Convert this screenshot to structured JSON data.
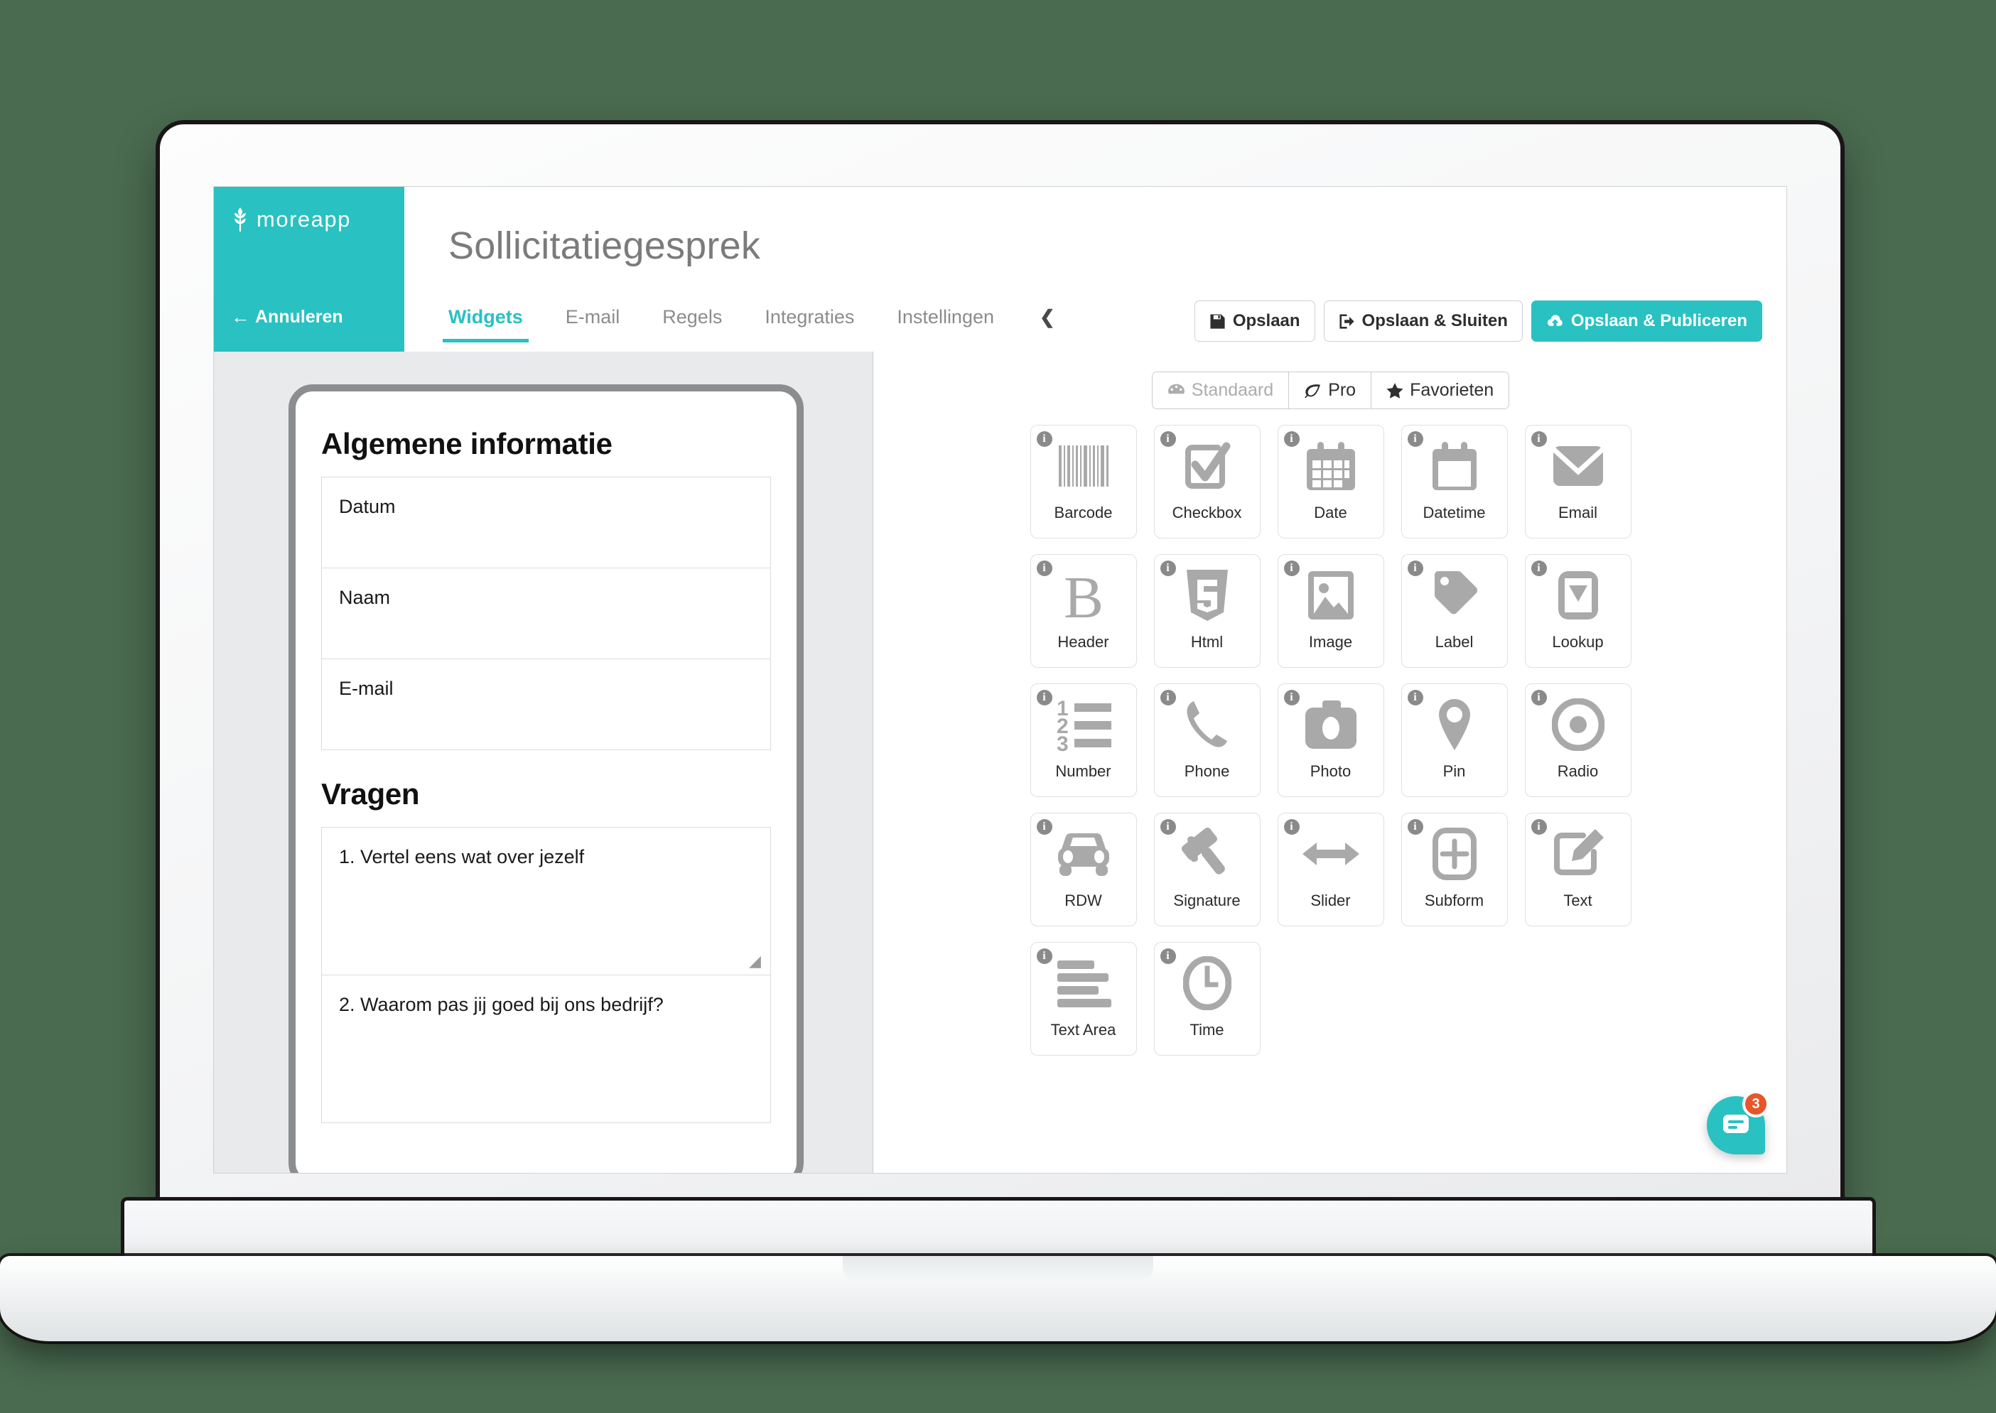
{
  "brand": {
    "logo_icon": "wheat-icon",
    "name": "moreapp",
    "cancel_label": "Annuleren",
    "cancel_icon": "arrow-left-icon",
    "color": "#29c1c1"
  },
  "header": {
    "form_title": "Sollicitatiegesprek"
  },
  "nav": {
    "tabs": [
      {
        "label": "Widgets",
        "active": true
      },
      {
        "label": "E-mail",
        "active": false
      },
      {
        "label": "Regels",
        "active": false
      },
      {
        "label": "Integraties",
        "active": false
      },
      {
        "label": "Instellingen",
        "active": false
      }
    ],
    "collapse_icon": "chevron-left-icon"
  },
  "actions": [
    {
      "label": "Opslaan",
      "icon": "floppy-disk-icon",
      "style": "default"
    },
    {
      "label": "Opslaan & Sluiten",
      "icon": "exit-icon",
      "style": "default"
    },
    {
      "label": "Opslaan & Publiceren",
      "icon": "cloud-upload-icon",
      "style": "primary"
    }
  ],
  "preview": {
    "sections": [
      {
        "title": "Algemene informatie",
        "fields": [
          {
            "label": "Datum",
            "tall": false
          },
          {
            "label": "Naam",
            "tall": false
          },
          {
            "label": "E-mail",
            "tall": false
          }
        ]
      },
      {
        "title": "Vragen",
        "fields": [
          {
            "label": "1. Vertel eens wat over jezelf",
            "tall": true,
            "resizable": true
          },
          {
            "label": "2. Waarom pas jij goed bij ons bedrijf?",
            "tall": true,
            "resizable": false
          }
        ]
      }
    ]
  },
  "widget_panel": {
    "categories": [
      {
        "label": "Standaard",
        "icon": "widgets-icon",
        "selected": true,
        "muted": true
      },
      {
        "label": "Pro",
        "icon": "leaf-icon",
        "selected": false,
        "muted": false
      },
      {
        "label": "Favorieten",
        "icon": "star-icon",
        "selected": false,
        "muted": false
      }
    ],
    "info_badge": "i",
    "widgets": [
      {
        "label": "Barcode",
        "icon": "barcode-icon"
      },
      {
        "label": "Checkbox",
        "icon": "checkbox-icon"
      },
      {
        "label": "Date",
        "icon": "calendar-icon"
      },
      {
        "label": "Datetime",
        "icon": "calendar-blank-icon"
      },
      {
        "label": "Email",
        "icon": "envelope-icon"
      },
      {
        "label": "Header",
        "icon": "bold-b-icon"
      },
      {
        "label": "Html",
        "icon": "html5-icon"
      },
      {
        "label": "Image",
        "icon": "picture-icon"
      },
      {
        "label": "Label",
        "icon": "tag-icon"
      },
      {
        "label": "Lookup",
        "icon": "dropdown-icon"
      },
      {
        "label": "Number",
        "icon": "numbered-list-icon"
      },
      {
        "label": "Phone",
        "icon": "phone-icon"
      },
      {
        "label": "Photo",
        "icon": "camera-icon"
      },
      {
        "label": "Pin",
        "icon": "map-pin-icon"
      },
      {
        "label": "Radio",
        "icon": "radio-button-icon"
      },
      {
        "label": "RDW",
        "icon": "car-icon"
      },
      {
        "label": "Signature",
        "icon": "gavel-icon"
      },
      {
        "label": "Slider",
        "icon": "arrows-horizontal-icon"
      },
      {
        "label": "Subform",
        "icon": "plus-box-icon"
      },
      {
        "label": "Text",
        "icon": "pencil-edit-icon"
      },
      {
        "label": "Text Area",
        "icon": "text-lines-icon"
      },
      {
        "label": "Time",
        "icon": "clock-icon"
      }
    ]
  },
  "chat": {
    "icon": "chat-bubble-icon",
    "badge_count": "3",
    "badge_color": "#e8552a"
  }
}
